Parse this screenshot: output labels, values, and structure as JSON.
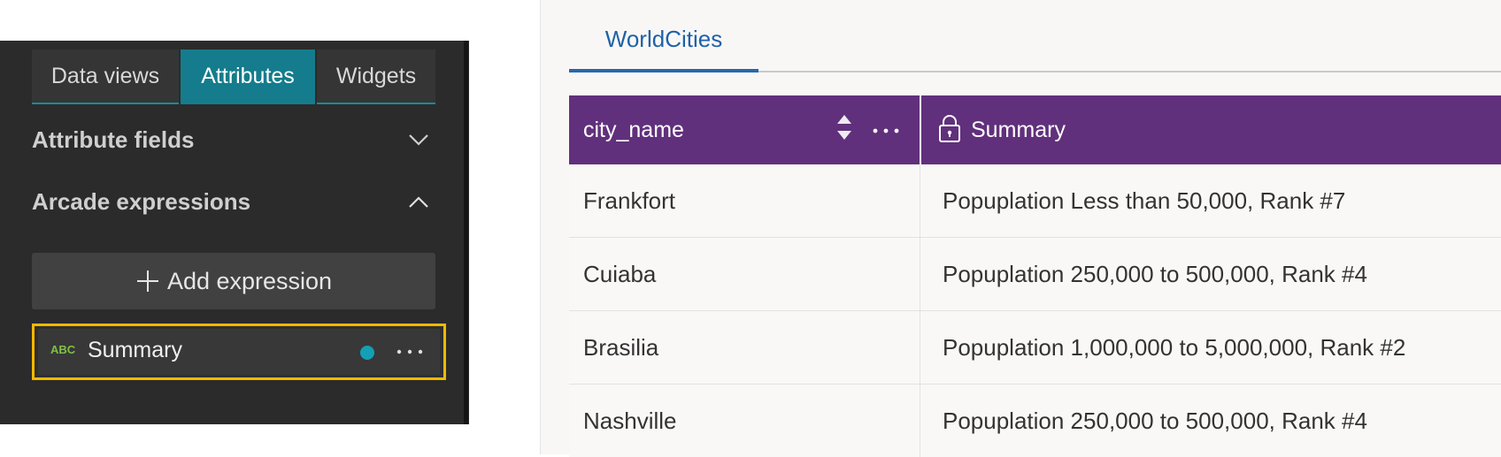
{
  "sidebar": {
    "tabs": [
      {
        "label": "Data views"
      },
      {
        "label": "Attributes"
      },
      {
        "label": "Widgets"
      }
    ],
    "active_tab": "Attributes",
    "attribute_fields": {
      "label": "Attribute fields",
      "icon": "chevron-down-icon"
    },
    "arcade_expressions": {
      "label": "Arcade expressions",
      "icon": "chevron-up-icon"
    },
    "add_expression": {
      "label": "Add expression",
      "icon": "plus-icon"
    },
    "expression": {
      "type_badge": "ABC",
      "label": "Summary",
      "status_color": "#13a0b5",
      "menu_icon": "more-icon"
    }
  },
  "table": {
    "tab": {
      "label": "WorldCities"
    },
    "header_color": "#61307c",
    "columns": [
      {
        "label": "city_name",
        "icons": [
          "sort-icon",
          "more-icon"
        ]
      },
      {
        "label": "Summary",
        "icons": [
          "lock-icon"
        ]
      }
    ],
    "rows": [
      {
        "city_name": "Frankfort",
        "summary": "Popuplation Less than 50,000, Rank #7"
      },
      {
        "city_name": "Cuiaba",
        "summary": "Popuplation 250,000 to 500,000, Rank #4"
      },
      {
        "city_name": "Brasilia",
        "summary": "Popuplation 1,000,000 to 5,000,000, Rank #2"
      },
      {
        "city_name": "Nashville",
        "summary": "Popuplation 250,000 to 500,000, Rank #4"
      }
    ]
  },
  "colors": {
    "panel_bg": "#2b2b2b",
    "active_tab": "#147c8c",
    "highlight_border": "#f5b800",
    "link_blue": "#1e62a8"
  }
}
